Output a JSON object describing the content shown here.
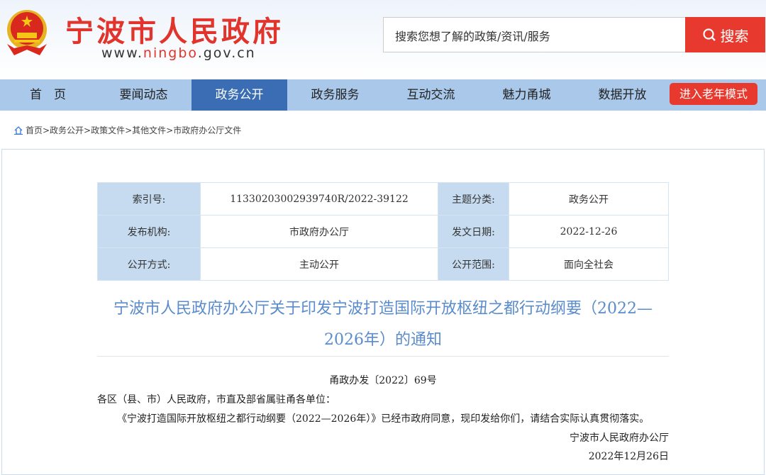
{
  "header": {
    "site_name": "宁波市人民政府",
    "url_prefix": "www.",
    "url_mid": "ningbo",
    "url_suffix": ".gov.cn",
    "search_placeholder": "搜索您想了解的政策/资讯/服务",
    "search_button": "搜索"
  },
  "nav": {
    "items": [
      {
        "label": "首　页"
      },
      {
        "label": "要闻动态"
      },
      {
        "label": "政务公开",
        "active": true
      },
      {
        "label": "政务服务"
      },
      {
        "label": "互动交流"
      },
      {
        "label": "魅力甬城"
      },
      {
        "label": "数据开放"
      }
    ],
    "elder_mode": "进入老年模式"
  },
  "breadcrumb": "首页>政务公开>政策文件>其他文件>市政府办公厅文件",
  "meta": [
    [
      "索引号:",
      "11330203002939740R/2022-39122",
      "主题分类:",
      "政务公开"
    ],
    [
      "发布机构:",
      "市政府办公厅",
      "发文日期:",
      "2022-12-26"
    ],
    [
      "公开方式:",
      "主动公开",
      "公开范围:",
      "面向全社会"
    ]
  ],
  "doc": {
    "title": "宁波市人民政府办公厅关于印发宁波打造国际开放枢纽之都行动纲要（2022—2026年）的通知",
    "doc_no": "甬政办发〔2022〕69号",
    "addressee": "各区（县、市）人民政府，市直及部省属驻甬各单位：",
    "body": "《宁波打造国际开放枢纽之都行动纲要（2022—2026年）》已经市政府同意，现印发给你们，请结合实际认真贯彻落实。",
    "signer": "宁波市人民政府办公厅",
    "date": "2022年12月26日"
  },
  "colors": {
    "red": "#e8392f",
    "nav": "#a9c8ea",
    "nav_active": "#3a6db3",
    "title": "#5a8ccb"
  }
}
